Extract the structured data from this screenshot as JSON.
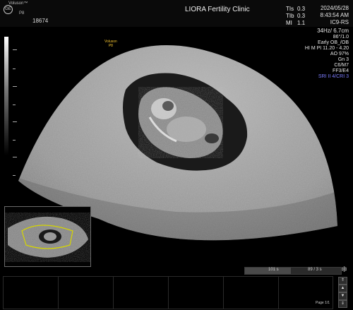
{
  "header": {
    "brand": "Voluson™",
    "model": "P8",
    "patient_id": "18674",
    "clinic": "LIORA Fertility Clinic",
    "indices": [
      {
        "label": "TIs",
        "value": "0.3"
      },
      {
        "label": "TIb",
        "value": "0.3"
      },
      {
        "label": "MI",
        "value": "1.1"
      }
    ],
    "date": "2024/05/28",
    "time": "8:43:54 AM",
    "probe": "IC9-RS"
  },
  "params": {
    "freq": "34Hz/ 6.7cm",
    "angle": "86°/1.0",
    "preset": "Early OB_/OB",
    "hi_line": "HI M PI 11.20 - 4.20",
    "ao": "AO 97%",
    "gn": "Gn   3",
    "c_m": "C6/M7",
    "ff_e": "FF3/E4",
    "sri": "SRI II 4/CRI 3"
  },
  "probe_label": {
    "brand": "Voluson",
    "model": "P8"
  },
  "cine": {
    "time": "101 s",
    "frames": "89 / 3 s",
    "progress": 0.48
  },
  "footer": {
    "page": "Page 1/1"
  },
  "colors": {
    "accent_yellow": "#f0c030",
    "sri_blue": "#7d7dff"
  }
}
